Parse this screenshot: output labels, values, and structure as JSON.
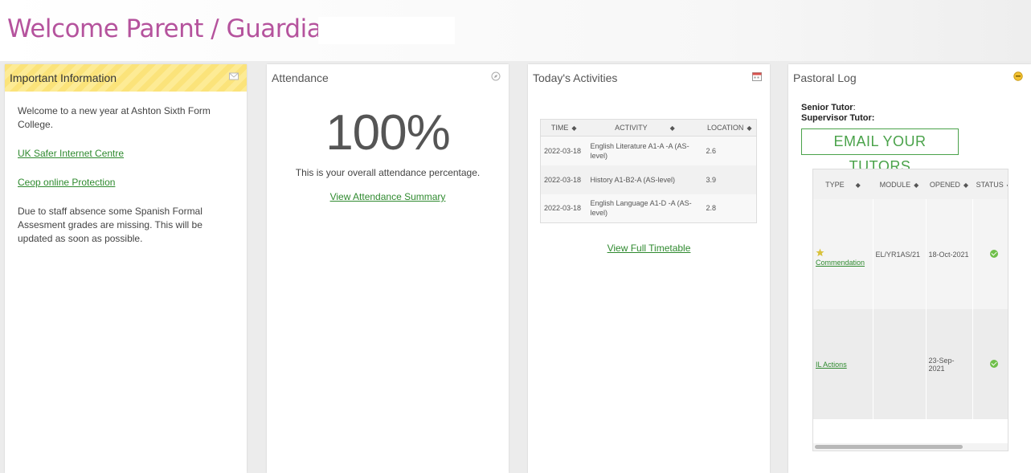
{
  "header": {
    "welcome": "Welcome Parent / Guardian Of"
  },
  "important": {
    "title": "Important Information",
    "icon": "envelope-icon",
    "welcome_text": "Welcome to a new year at Ashton Sixth Form College.",
    "links": [
      "UK Safer Internet Centre",
      "Ceop online Protection"
    ],
    "notice": "Due to staff absence some Spanish Formal Assesment grades are missing.  This will be updated as soon as possible."
  },
  "attendance": {
    "title": "Attendance",
    "icon": "compass-icon",
    "percent": "100%",
    "description": "This is your overall attendance percentage.",
    "link": "View Attendance Summary"
  },
  "activities": {
    "title": "Today's Activities",
    "icon": "calendar-icon",
    "columns": [
      "TIME",
      "ACTIVITY",
      "LOCATION"
    ],
    "rows": [
      {
        "time": "2022-03-18",
        "activity": "English Literature A1-A -A (AS-level)",
        "location": "2.6"
      },
      {
        "time": "2022-03-18",
        "activity": "History A1-B2-A (AS-level)",
        "location": "3.9"
      },
      {
        "time": "2022-03-18",
        "activity": "English Language A1-D -A (AS-level)",
        "location": "2.8"
      }
    ],
    "link": "View Full Timetable"
  },
  "pastoral": {
    "title": "Pastoral Log",
    "icon": "smiley-icon",
    "senior_tutor_label": "Senior Tutor",
    "senior_tutor_colon": ":",
    "supervisor_tutor_label": "Supervisor Tutor:",
    "email_button": "EMAIL YOUR TUTORS",
    "columns": [
      "TYPE",
      "MODULE",
      "OPENED",
      "STATUS"
    ],
    "rows": [
      {
        "type": "Commendation",
        "module": "EL/YR1AS/21",
        "opened": "18-Oct-2021",
        "status": "complete"
      },
      {
        "type": "IL Actions",
        "module": "",
        "opened": "23-Sep-2021",
        "status": "complete"
      }
    ],
    "scroll_position": 0.0
  }
}
